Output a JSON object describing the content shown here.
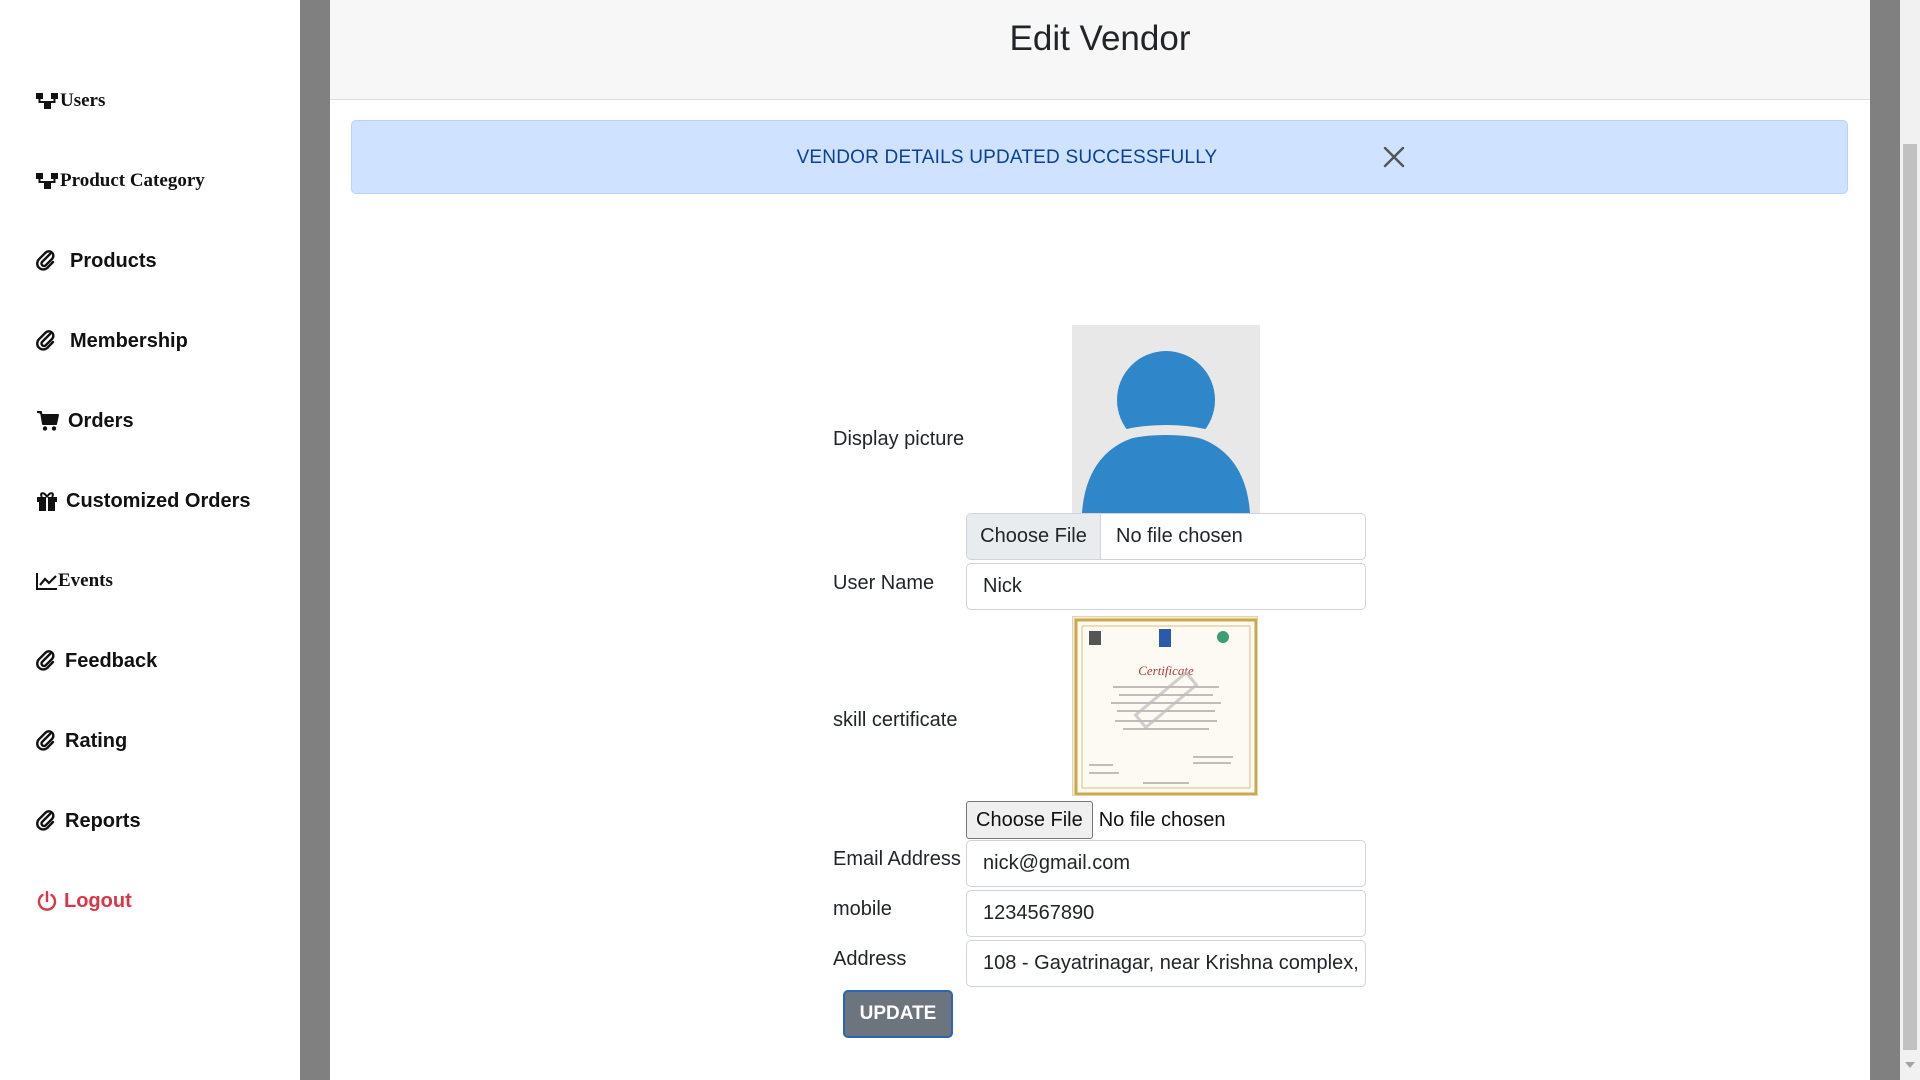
{
  "sidebar": {
    "items": [
      {
        "label": "Users",
        "icon": "sitemap-icon"
      },
      {
        "label": "Product Category",
        "icon": "sitemap-icon"
      },
      {
        "label": "Products",
        "icon": "paperclip-icon"
      },
      {
        "label": "Membership",
        "icon": "paperclip-icon"
      },
      {
        "label": "Orders",
        "icon": "cart-icon"
      },
      {
        "label": "Customized Orders",
        "icon": "gift-icon"
      },
      {
        "label": "Events",
        "icon": "chart-line-icon"
      },
      {
        "label": "Feedback",
        "icon": "paperclip-icon"
      },
      {
        "label": "Rating",
        "icon": "paperclip-icon"
      },
      {
        "label": "Reports",
        "icon": "paperclip-icon"
      }
    ],
    "logout": {
      "label": "Logout",
      "icon": "power-icon",
      "color": "#dc3545"
    }
  },
  "modal": {
    "title": "Edit Vendor",
    "alert": {
      "message": "VENDOR DETAILS UPDATED SUCCESSFULLY",
      "color": "#cfe2ff"
    }
  },
  "form": {
    "display_picture": {
      "label": "Display picture",
      "file_button": "Choose File",
      "file_status": "No file chosen"
    },
    "user_name": {
      "label": "User Name",
      "value": "Nick"
    },
    "skill_certificate": {
      "label": "skill certificate",
      "image_title": "Certificate",
      "file_button": "Choose File",
      "file_status": "No file chosen"
    },
    "email": {
      "label": "Email Address",
      "value": "nick@gmail.com"
    },
    "mobile": {
      "label": "mobile",
      "value": "1234567890"
    },
    "address": {
      "label": "Address",
      "value": "108 - Gayatrinagar, near Krishna complex,"
    },
    "submit_label": "UPDATE"
  }
}
